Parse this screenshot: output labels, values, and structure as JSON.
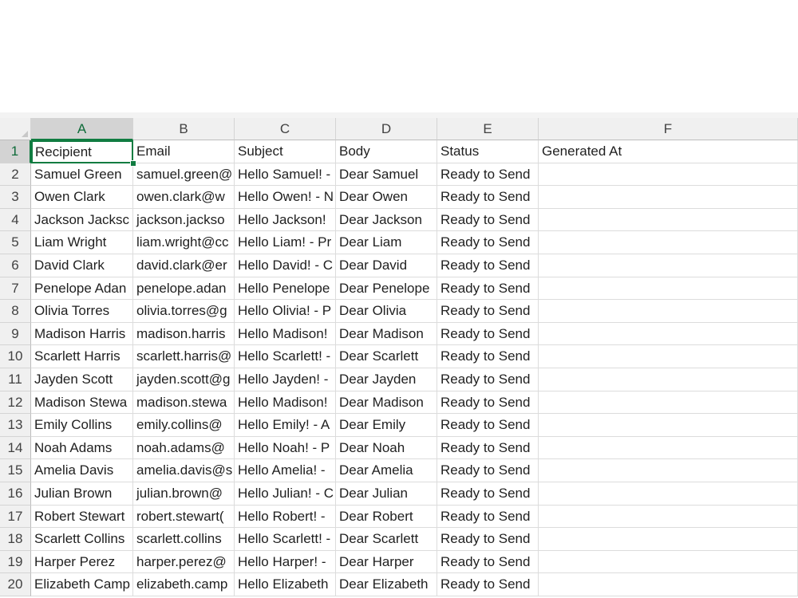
{
  "columns": [
    "A",
    "B",
    "C",
    "D",
    "E",
    "F"
  ],
  "active_cell": "A1",
  "accent_color": "#107c41",
  "header_row": [
    "Recipient",
    "Email",
    "Subject",
    "Body",
    "Status",
    "Generated At"
  ],
  "rows": [
    {
      "num": "2",
      "cells": [
        "Samuel Green",
        "samuel.green@",
        "Hello Samuel! -",
        "Dear Samuel",
        "Ready to Send",
        ""
      ]
    },
    {
      "num": "3",
      "cells": [
        "Owen Clark",
        "owen.clark@w",
        "Hello Owen! - N",
        "Dear Owen",
        "Ready to Send",
        ""
      ]
    },
    {
      "num": "4",
      "cells": [
        "Jackson Jacksc",
        "jackson.jackso",
        "Hello Jackson!",
        "Dear Jackson",
        "Ready to Send",
        ""
      ]
    },
    {
      "num": "5",
      "cells": [
        "Liam Wright",
        "liam.wright@cc",
        "Hello Liam! - Pr",
        "Dear Liam",
        "Ready to Send",
        ""
      ]
    },
    {
      "num": "6",
      "cells": [
        "David Clark",
        "david.clark@er",
        "Hello David! - C",
        "Dear David",
        "Ready to Send",
        ""
      ]
    },
    {
      "num": "7",
      "cells": [
        "Penelope Adan",
        "penelope.adan",
        "Hello Penelope",
        "Dear Penelope",
        "Ready to Send",
        ""
      ]
    },
    {
      "num": "8",
      "cells": [
        "Olivia Torres",
        "olivia.torres@g",
        "Hello Olivia! - P",
        "Dear Olivia",
        "Ready to Send",
        ""
      ]
    },
    {
      "num": "9",
      "cells": [
        "Madison Harris",
        "madison.harris",
        "Hello Madison!",
        "Dear Madison",
        "Ready to Send",
        ""
      ]
    },
    {
      "num": "10",
      "cells": [
        "Scarlett Harris",
        "scarlett.harris@",
        "Hello Scarlett! -",
        "Dear Scarlett",
        "Ready to Send",
        ""
      ]
    },
    {
      "num": "11",
      "cells": [
        "Jayden Scott",
        "jayden.scott@g",
        "Hello Jayden! -",
        "Dear Jayden",
        "Ready to Send",
        ""
      ]
    },
    {
      "num": "12",
      "cells": [
        "Madison Stewa",
        "madison.stewa",
        "Hello Madison!",
        "Dear Madison",
        "Ready to Send",
        ""
      ]
    },
    {
      "num": "13",
      "cells": [
        "Emily Collins",
        "emily.collins@",
        "Hello Emily! - A",
        "Dear Emily",
        "Ready to Send",
        ""
      ]
    },
    {
      "num": "14",
      "cells": [
        "Noah Adams",
        "noah.adams@",
        "Hello Noah! - P",
        "Dear Noah",
        "Ready to Send",
        ""
      ]
    },
    {
      "num": "15",
      "cells": [
        "Amelia Davis",
        "amelia.davis@s",
        "Hello Amelia! -",
        "Dear Amelia",
        "Ready to Send",
        ""
      ]
    },
    {
      "num": "16",
      "cells": [
        "Julian Brown",
        "julian.brown@",
        "Hello Julian! - C",
        "Dear Julian",
        "Ready to Send",
        ""
      ]
    },
    {
      "num": "17",
      "cells": [
        "Robert Stewart",
        "robert.stewart(",
        "Hello Robert! -",
        "Dear Robert",
        "Ready to Send",
        ""
      ]
    },
    {
      "num": "18",
      "cells": [
        "Scarlett Collins",
        "scarlett.collins",
        "Hello Scarlett! -",
        "Dear Scarlett",
        "Ready to Send",
        ""
      ]
    },
    {
      "num": "19",
      "cells": [
        "Harper Perez",
        "harper.perez@",
        "Hello Harper! -",
        "Dear Harper",
        "Ready to Send",
        ""
      ]
    },
    {
      "num": "20",
      "cells": [
        "Elizabeth Camp",
        "elizabeth.camp",
        "Hello Elizabeth",
        "Dear Elizabeth",
        "Ready to Send",
        ""
      ]
    }
  ]
}
